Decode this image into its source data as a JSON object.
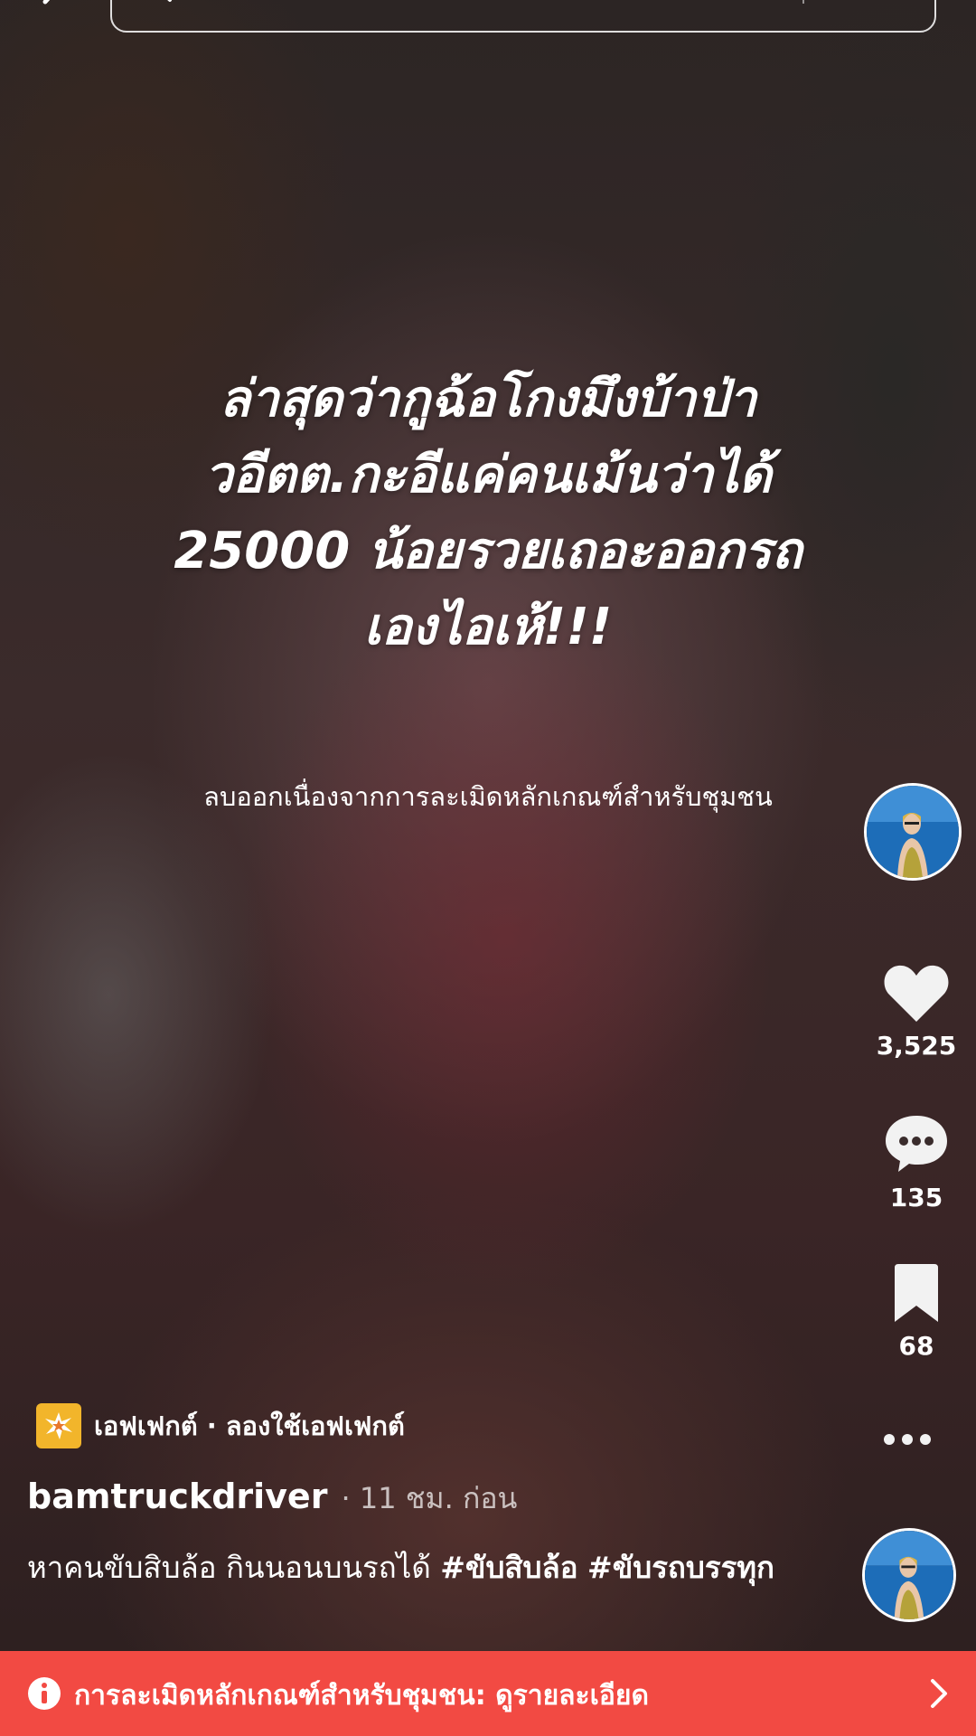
{
  "search": {
    "placeholder": "ค้นหาเนื้อหาเพิ่มเติม",
    "button_label": "ค้นหา"
  },
  "video": {
    "headline_lines": [
      "ล่าสุดว่ากูฉ้อโกงมึงบ้าป่า",
      "วอีตต.กะอีแค่คนเม้นว่าได้",
      "25000 น้อยรวยเถอะออกรถ",
      "เองไอเห้!!!"
    ],
    "removed_notice": "ลบออกเนื่องจากการละเมิดหลักเกณฑ์สำหรับชุมชน"
  },
  "actions": {
    "likes": "3,525",
    "comments": "135",
    "saves": "68"
  },
  "effect": {
    "label": "เอฟเฟกต์ · ลองใช้เอฟเฟกต์",
    "icon_color": "#f2b52b"
  },
  "post": {
    "username": "bamtruckdriver",
    "time": "· 11 ชม. ก่อน",
    "caption_text": "หาคนขับสิบล้อ กินนอนบนรถได้ ",
    "hashtags": [
      "#ขับสิบล้อ",
      "#ขับรถบรรทุก"
    ]
  },
  "violation_bar": {
    "text": "การละเมิดหลักเกณฑ์สำหรับชุมชน: ดูรายละเอียด",
    "color": "#f24a43"
  },
  "icons": [
    "back-icon",
    "search-icon",
    "heart-icon",
    "comment-icon",
    "bookmark-icon",
    "more-icon",
    "info-icon",
    "chevron-right-icon"
  ]
}
